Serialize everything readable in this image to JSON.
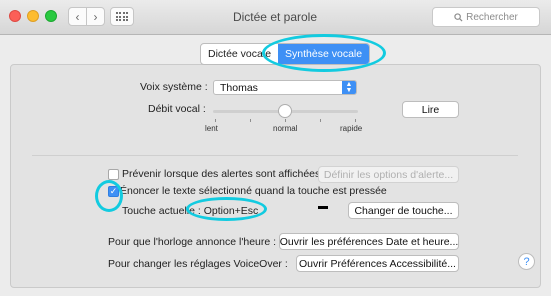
{
  "window": {
    "title": "Dictée et parole"
  },
  "toolbar": {
    "search_placeholder": "Rechercher",
    "back_glyph": "‹",
    "forward_glyph": "›"
  },
  "tabs": [
    {
      "label": "Dictée vocale",
      "active": false
    },
    {
      "label": "Synthèse vocale",
      "active": true
    }
  ],
  "voice": {
    "label": "Voix système :",
    "value": "Thomas"
  },
  "rate": {
    "label": "Débit vocal :",
    "slow": "lent",
    "normal": "normal",
    "fast": "rapide",
    "level": 0.5,
    "play_button": "Lire"
  },
  "alerts": {
    "label": "Prévenir lorsque des alertes sont affichées",
    "checked": false,
    "options_button": "Définir les options d'alerte..."
  },
  "speak_selection": {
    "label": "Énoncer le texte sélectionné quand la touche est pressée",
    "checked": true,
    "key_label": "Touche actuelle : Option+Esc",
    "change_button": "Changer de touche..."
  },
  "clock": {
    "label": "Pour que l'horloge annonce l'heure :",
    "button": "Ouvrir les préférences Date et heure..."
  },
  "voiceover": {
    "label": "Pour changer les réglages VoiceOver :",
    "button": "Ouvrir Préférences Accessibilité..."
  },
  "help": {
    "glyph": "?"
  },
  "colors": {
    "accent": "#3e90f5",
    "annotation": "#12cbe0",
    "close": "#fc5f57",
    "minimize": "#fdbc2e",
    "zoom": "#29c940"
  }
}
